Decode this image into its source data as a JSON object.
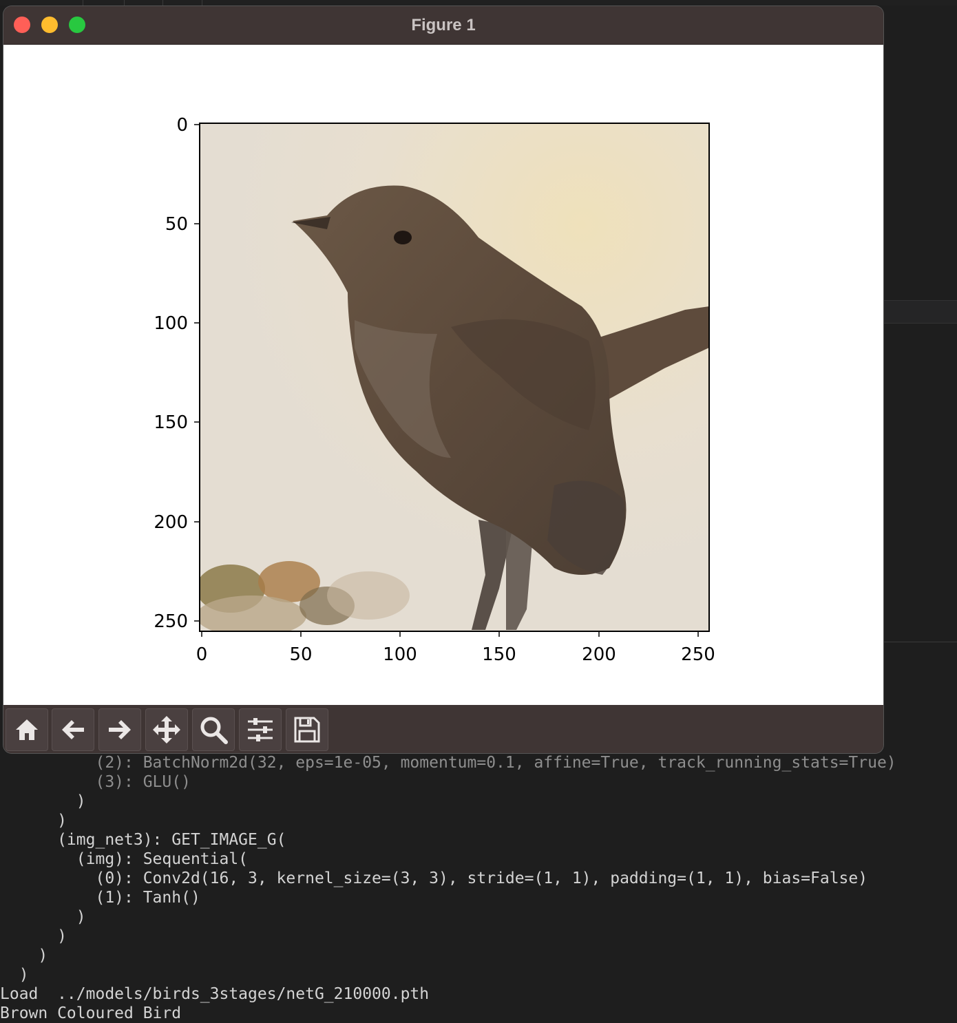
{
  "window": {
    "title": "Figure 1"
  },
  "figure": {
    "y_ticks": [
      "0",
      "50",
      "100",
      "150",
      "200",
      "250"
    ],
    "x_ticks": [
      "0",
      "50",
      "100",
      "150",
      "200",
      "250"
    ],
    "image_description_icon": "bird-image"
  },
  "toolbar": {
    "buttons": [
      {
        "name": "home",
        "icon": "home-icon"
      },
      {
        "name": "back",
        "icon": "arrow-left-icon"
      },
      {
        "name": "forward",
        "icon": "arrow-right-icon"
      },
      {
        "name": "pan",
        "icon": "move-icon"
      },
      {
        "name": "zoom",
        "icon": "magnifier-icon"
      },
      {
        "name": "configure-subplots",
        "icon": "sliders-icon"
      },
      {
        "name": "save",
        "icon": "floppy-disk-icon"
      }
    ]
  },
  "console": {
    "lines": [
      "          (2): BatchNorm2d(32, eps=1e-05, momentum=0.1, affine=True, track_running_stats=True)",
      "          (3): GLU()",
      "        )",
      "      )",
      "      (img_net3): GET_IMAGE_G(",
      "        (img): Sequential(",
      "          (0): Conv2d(16, 3, kernel_size=(3, 3), stride=(1, 1), padding=(1, 1), bias=False)",
      "          (1): Tanh()",
      "        )",
      "      )",
      "    )",
      "  )",
      "Load  ../models/birds_3stages/netG_210000.pth",
      "Brown Coloured Bird"
    ]
  }
}
